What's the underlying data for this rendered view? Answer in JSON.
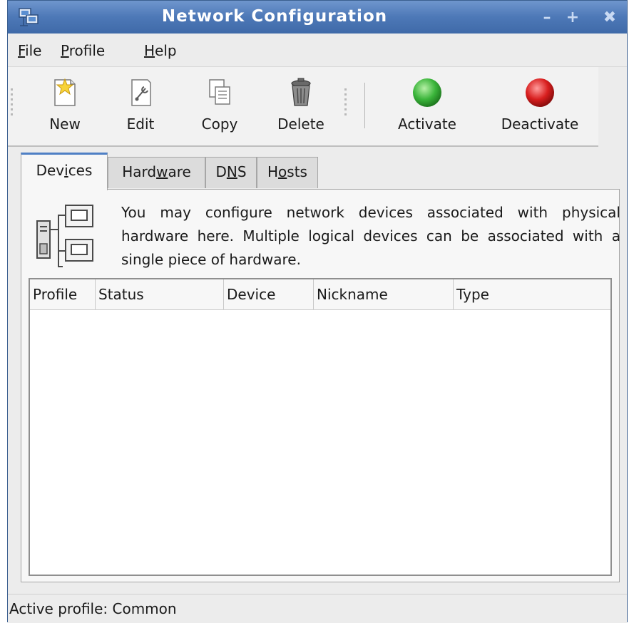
{
  "window": {
    "title": "Network Configuration",
    "minimize_glyph": "–",
    "maximize_glyph": "+",
    "close_glyph": "✖"
  },
  "menu": [
    {
      "mnemonic": "F",
      "rest": "ile"
    },
    {
      "mnemonic": "P",
      "rest": "rofile"
    },
    {
      "mnemonic": "H",
      "rest": "elp"
    }
  ],
  "toolbar": {
    "new_label": "New",
    "edit_label": "Edit",
    "copy_label": "Copy",
    "delete_label": "Delete",
    "activate_label": "Activate",
    "deactivate_label": "Deactivate",
    "activate_color": "#3bb53b",
    "deactivate_color": "#d81e1e"
  },
  "tabs": [
    {
      "pre": "Dev",
      "mnemonic": "i",
      "post": "ces"
    },
    {
      "pre": "Hard",
      "mnemonic": "w",
      "post": "are"
    },
    {
      "pre": "D",
      "mnemonic": "N",
      "post": "S"
    },
    {
      "pre": "H",
      "mnemonic": "o",
      "post": "sts"
    }
  ],
  "devices": {
    "description": "You may configure network devices associated with physical hardware here. Multiple logical devices can be associated with a single piece of hardware.",
    "columns": [
      "Profile",
      "Status",
      "Device",
      "Nickname",
      "Type"
    ],
    "rows": []
  },
  "status": {
    "text": "Active profile: Common"
  },
  "colors": {
    "titlebar": "#4d78b7",
    "active_tab_accent": "#4f80c5"
  }
}
